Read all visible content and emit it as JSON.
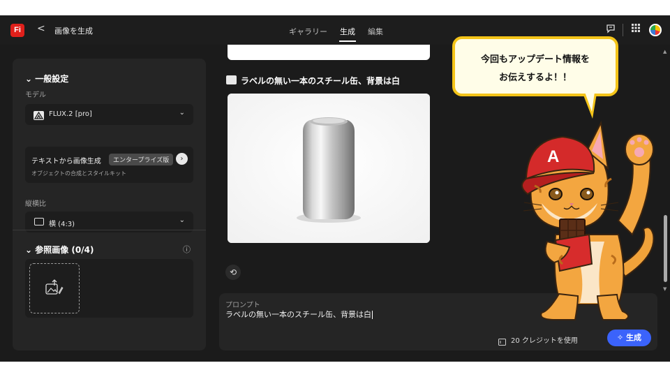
{
  "app": {
    "logo": "Fi",
    "back_symbol": "<",
    "title": "画像を生成",
    "tabs": [
      "ギャラリー",
      "生成",
      "編集"
    ],
    "active_tab": "生成"
  },
  "general_settings": {
    "title": "一般設定",
    "model_label": "モデル",
    "model_value": "FLUX.2 [pro]",
    "mode_title": "テキストから画像生成",
    "mode_badge": "エンタープライズ版",
    "mode_subtitle": "オブジェクトの合成とスタイルキット",
    "aspect_label": "縦横比",
    "aspect_value": "横 (4:3)"
  },
  "reference": {
    "title": "参照画像 (0/4)",
    "info_symbol": "ⓘ"
  },
  "result": {
    "prompt_heading": "ラベルの無い一本のスチール缶、背景は白"
  },
  "prompt_box": {
    "label": "プロンプト",
    "value": "ラベルの無い一本のスチール缶、背景は白",
    "credits": "20 クレジットを使用",
    "generate_label": "生成"
  },
  "overlay": {
    "line1": "今回もアップデート情報を",
    "line2": "お伝えするよ！！",
    "cap_letter": "A"
  },
  "icons": {
    "back": "chevron-left-icon",
    "feedback": "feedback-icon",
    "apps": "app-grid-icon",
    "history": "history-icon"
  },
  "colors": {
    "accent_blue": "#3b63fb",
    "logo_red": "#e0201b",
    "bubble_border": "#f4c419",
    "panel_bg": "#252525",
    "app_bg": "#1b1b1b"
  }
}
